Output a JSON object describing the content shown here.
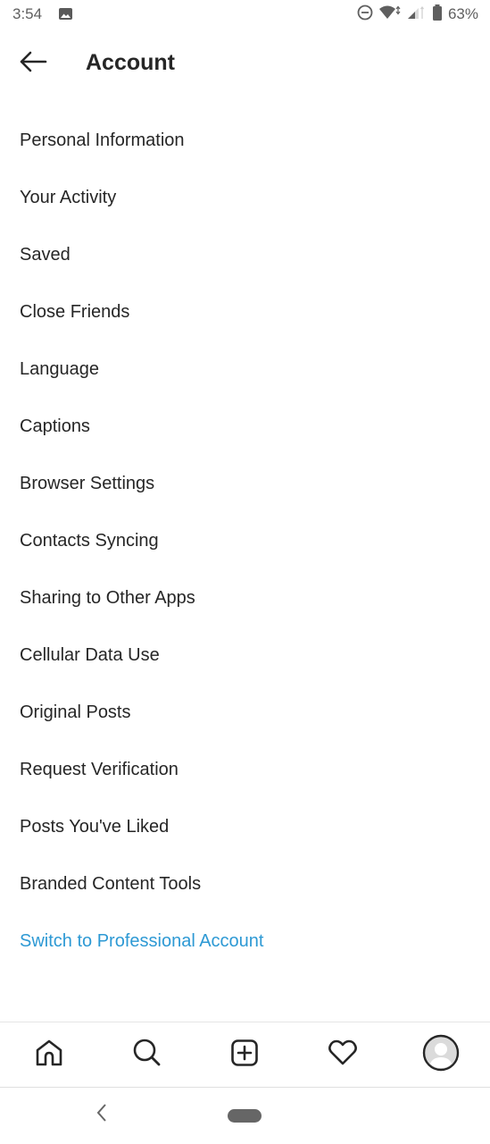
{
  "status_bar": {
    "time": "3:54",
    "battery_percent": "63%",
    "icons": [
      "gallery-icon",
      "do-not-disturb-icon",
      "wifi-icon",
      "cell-signal-icon",
      "battery-icon"
    ]
  },
  "header": {
    "back_icon": "arrow-left-icon",
    "title": "Account"
  },
  "menu": {
    "items": [
      {
        "label": "Personal Information"
      },
      {
        "label": "Your Activity"
      },
      {
        "label": "Saved"
      },
      {
        "label": "Close Friends"
      },
      {
        "label": "Language"
      },
      {
        "label": "Captions"
      },
      {
        "label": "Browser Settings"
      },
      {
        "label": "Contacts Syncing"
      },
      {
        "label": "Sharing to Other Apps"
      },
      {
        "label": "Cellular Data Use"
      },
      {
        "label": "Original Posts"
      },
      {
        "label": "Request Verification"
      },
      {
        "label": "Posts You've Liked"
      },
      {
        "label": "Branded Content Tools"
      }
    ],
    "link": {
      "label": "Switch to Professional Account",
      "color": "#2d99d4"
    }
  },
  "tab_bar": {
    "tabs": [
      {
        "name": "home",
        "icon": "home-icon"
      },
      {
        "name": "search",
        "icon": "search-icon"
      },
      {
        "name": "new-post",
        "icon": "plus-square-icon"
      },
      {
        "name": "activity",
        "icon": "heart-icon"
      },
      {
        "name": "profile",
        "icon": "avatar-icon"
      }
    ]
  },
  "system_nav": {
    "back_icon": "chevron-left-icon",
    "home_icon": "home-pill-icon"
  }
}
